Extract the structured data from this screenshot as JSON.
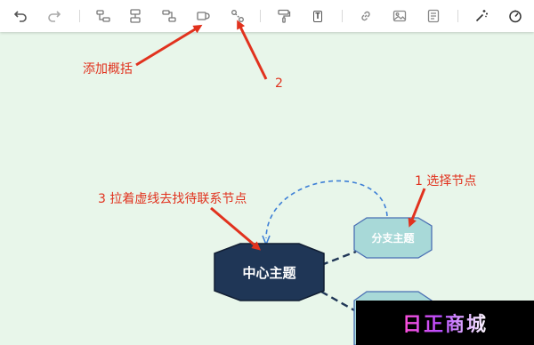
{
  "toolbar": {
    "buttons": [
      {
        "name": "undo-icon"
      },
      {
        "name": "redo-icon"
      },
      {
        "name": "add-subtopic-icon"
      },
      {
        "name": "add-sibling-icon"
      },
      {
        "name": "add-parent-icon"
      },
      {
        "name": "add-summary-icon"
      },
      {
        "name": "add-relation-icon"
      },
      {
        "name": "format-painter-icon"
      },
      {
        "name": "text-box-icon",
        "glyph": "T"
      },
      {
        "name": "link-icon"
      },
      {
        "name": "image-icon"
      },
      {
        "name": "note-icon"
      },
      {
        "name": "magic-wand-icon"
      },
      {
        "name": "navigator-icon"
      }
    ]
  },
  "annotations": {
    "add_summary": "添加概括",
    "step2": "2",
    "step1": "1 选择节点",
    "step3": "3 拉着虚线去找待联系节点"
  },
  "nodes": {
    "central": "中心主题",
    "branch": "分支主题"
  },
  "watermark": "日正商城",
  "colors": {
    "annotation": "#e1321e",
    "central_fill": "#1f3656",
    "branch_fill": "#a8d9d8",
    "branch_border": "#4a6fb3",
    "relation_line": "#3d7fd6",
    "background": "#e8f6ea"
  }
}
